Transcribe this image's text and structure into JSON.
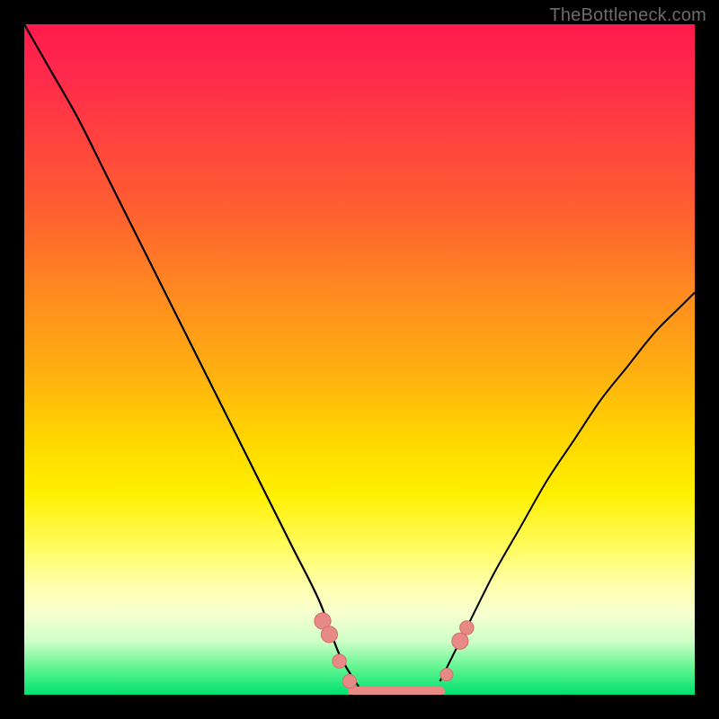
{
  "watermark": "TheBottleneck.com",
  "colors": {
    "frame_background_top": "#ff1a4d",
    "frame_background_bottom": "#00e070",
    "curve_stroke": "#000000",
    "marker_fill": "#e78a85",
    "page_background": "#000000"
  },
  "chart_data": {
    "type": "line",
    "title": "",
    "xlabel": "",
    "ylabel": "",
    "xlim": [
      0,
      100
    ],
    "ylim": [
      0,
      100
    ],
    "grid": false,
    "series": [
      {
        "name": "left-curve",
        "x": [
          0,
          4,
          8,
          12,
          16,
          20,
          24,
          28,
          32,
          36,
          40,
          44,
          47,
          50
        ],
        "values": [
          100,
          93,
          86,
          78,
          70,
          62,
          54,
          46,
          38,
          30,
          22,
          14,
          6,
          1
        ]
      },
      {
        "name": "right-curve",
        "x": [
          62,
          66,
          70,
          74,
          78,
          82,
          86,
          90,
          94,
          98,
          100
        ],
        "values": [
          2,
          10,
          18,
          25,
          32,
          38,
          44,
          49,
          54,
          58,
          60
        ]
      },
      {
        "name": "bottom-flat",
        "x": [
          49,
          62
        ],
        "values": [
          0.5,
          0.5
        ]
      }
    ],
    "markers": [
      {
        "x": 44.5,
        "y": 11,
        "r": 1.3
      },
      {
        "x": 45.5,
        "y": 9,
        "r": 1.3
      },
      {
        "x": 47.0,
        "y": 5,
        "r": 1.1
      },
      {
        "x": 48.5,
        "y": 2,
        "r": 1.1
      },
      {
        "x": 63.0,
        "y": 3,
        "r": 1.0
      },
      {
        "x": 65.0,
        "y": 8,
        "r": 1.3
      },
      {
        "x": 66.0,
        "y": 10,
        "r": 1.1
      }
    ],
    "annotations": []
  }
}
